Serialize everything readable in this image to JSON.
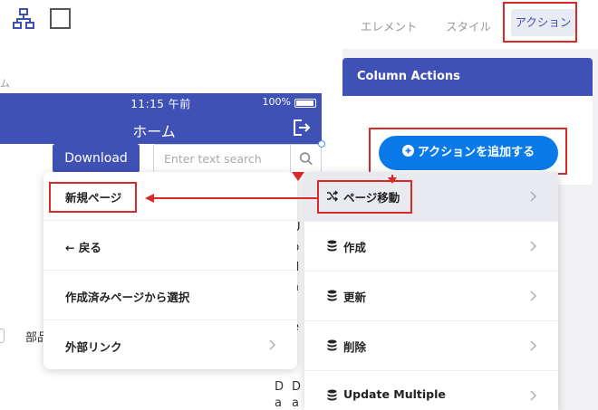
{
  "canvas": {
    "label_fragment": "ム",
    "status_time": "11:15 午前",
    "battery_percent": "100%",
    "header_title": "ホーム",
    "download_label": "Download",
    "search_placeholder": "Enter text search",
    "hidden_label": "部品",
    "bg_chars": [
      "U",
      "p",
      "d",
      "a",
      "t",
      "e",
      "D",
      "a",
      "D",
      "a"
    ]
  },
  "tabs": {
    "element": "エレメント",
    "style": "スタイル",
    "action": "アクション"
  },
  "column_actions": {
    "title": "Column Actions",
    "add_button": "アクションを追加する"
  },
  "nav_menu": {
    "items": [
      "新規ページ",
      "← 戻る",
      "作成済みページから選択",
      "外部リンク"
    ]
  },
  "action_menu": {
    "items": [
      "ページ移動",
      "作成",
      "更新",
      "削除",
      "Update Multiple"
    ]
  },
  "colors": {
    "primary": "#3f51b5",
    "add_button": "#0a7ae8",
    "annotation": "#d92a2a"
  }
}
